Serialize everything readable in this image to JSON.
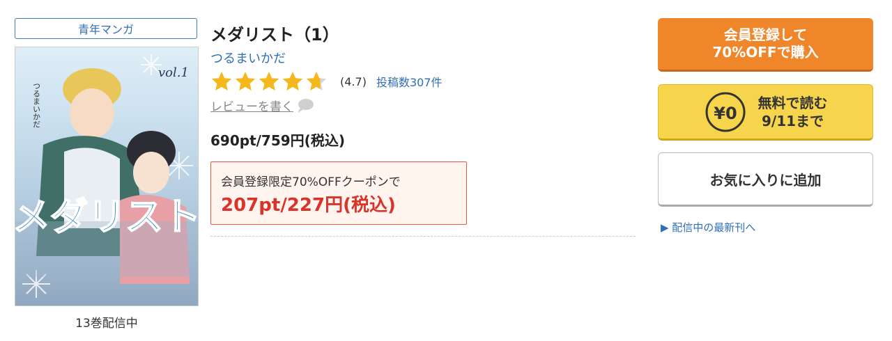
{
  "genre": "青年マンガ",
  "cover": {
    "title_text": "メダリスト",
    "author_text": "つるまいかだ",
    "vol_text": "vol.1"
  },
  "volumes_label": "13巻配信中",
  "book": {
    "title": "メダリスト（1）",
    "author": "つるまいかだ",
    "rating": 4.7,
    "rating_text": "(4.7)",
    "review_count": "投稿数307件",
    "write_review": "レビューを書く",
    "price": "690pt/759円(税込)"
  },
  "coupon": {
    "label": "会員登録限定70%OFFクーポンで",
    "price": "207pt/227円(税込)"
  },
  "buttons": {
    "buy_line1": "会員登録して",
    "buy_line2": "70%OFFで購入",
    "free_badge": "¥0",
    "free_line1": "無料で読む",
    "free_line2": "9/11まで",
    "favorite": "お気に入りに追加"
  },
  "latest_link": "▶ 配信中の最新刊へ",
  "colors": {
    "link": "#2f6fb8",
    "buy_button": "#f0862a",
    "free_button": "#f6d44c",
    "coupon_price": "#d9342b",
    "star": "#f5b81c"
  }
}
